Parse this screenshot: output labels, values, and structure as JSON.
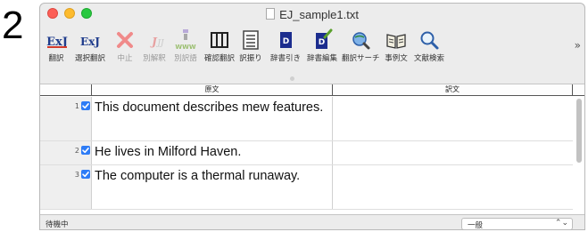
{
  "step_number": "2",
  "window": {
    "title": "EJ_sample1.txt"
  },
  "toolbar": {
    "items": [
      {
        "label": "翻訳",
        "icon": "translate-icon",
        "enabled": true
      },
      {
        "label": "選択翻訳",
        "icon": "selection-translate-icon",
        "enabled": true
      },
      {
        "label": "中止",
        "icon": "stop-icon",
        "enabled": false
      },
      {
        "label": "別解釈",
        "icon": "alt-interpretation-icon",
        "enabled": false
      },
      {
        "label": "別訳語",
        "icon": "alt-word-icon",
        "enabled": false
      },
      {
        "label": "確認翻訳",
        "icon": "confirm-translate-icon",
        "enabled": true
      },
      {
        "label": "訳振り",
        "icon": "interlinear-icon",
        "enabled": true
      },
      {
        "label": "辞書引き",
        "icon": "dictionary-lookup-icon",
        "enabled": true
      },
      {
        "label": "辞書編集",
        "icon": "dictionary-edit-icon",
        "enabled": true
      },
      {
        "label": "翻訳サーチ",
        "icon": "translation-search-icon",
        "enabled": true
      },
      {
        "label": "事例文",
        "icon": "example-sentences-icon",
        "enabled": true
      },
      {
        "label": "文献検索",
        "icon": "literature-search-icon",
        "enabled": true
      }
    ],
    "overflow": "»"
  },
  "table": {
    "headers": {
      "source": "原文",
      "target": "訳文"
    },
    "rows": [
      {
        "num": "1",
        "checked": true,
        "source": "This document describes mew features.",
        "target": ""
      },
      {
        "num": "2",
        "checked": true,
        "source": "He lives in Milford Haven.",
        "target": ""
      },
      {
        "num": "3",
        "checked": true,
        "source": "The computer is a thermal runaway.",
        "target": ""
      }
    ]
  },
  "status": {
    "text": "待機中",
    "mode_value": "一般"
  },
  "colors": {
    "accent": "#2e7cf6",
    "close": "#fc5f57",
    "minimize": "#fdbb2e",
    "maximize": "#29c840"
  }
}
